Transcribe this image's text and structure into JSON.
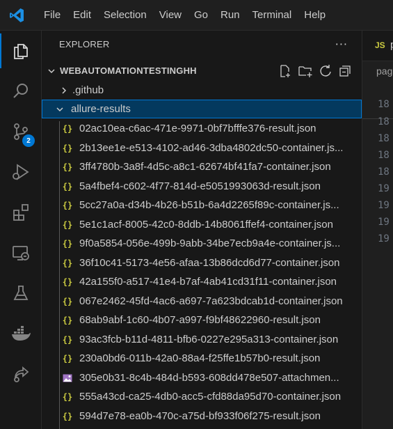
{
  "menu": [
    "File",
    "Edit",
    "Selection",
    "View",
    "Go",
    "Run",
    "Terminal",
    "Help"
  ],
  "activity_bar": {
    "items": [
      "explorer-icon",
      "search-icon",
      "source-control-icon",
      "run-debug-icon",
      "extensions-icon",
      "remote-explorer-icon",
      "testing-icon",
      "docker-icon",
      "live-share-icon"
    ],
    "source_control_badge": "2"
  },
  "explorer": {
    "header": "EXPLORER",
    "more": "···",
    "root": "WEBAUTOMATIONTESTINGHH",
    "folders": [
      ".github",
      "allure-results"
    ],
    "files": [
      {
        "name": "02ac10ea-c6ac-471e-9971-0bf7bfffe376-result.json",
        "icon": "json-icon"
      },
      {
        "name": "2b13ee1e-e513-4102-ad46-3dba4802dc50-container.js...",
        "icon": "json-icon"
      },
      {
        "name": "3ff4780b-3a8f-4d5c-a8c1-62674bf41fa7-container.json",
        "icon": "json-icon"
      },
      {
        "name": "5a4fbef4-c602-4f77-814d-e5051993063d-result.json",
        "icon": "json-icon"
      },
      {
        "name": "5cc27a0a-d34b-4b26-b51b-6a4d2265f89c-container.js...",
        "icon": "json-icon"
      },
      {
        "name": "5e1c1acf-8005-42c0-8ddb-14b8061ffef4-container.json",
        "icon": "json-icon"
      },
      {
        "name": "9f0a5854-056e-499b-9abb-34be7ecb9a4e-container.js...",
        "icon": "json-icon"
      },
      {
        "name": "36f10c41-5173-4e56-afaa-13b86dcd6d77-container.json",
        "icon": "json-icon"
      },
      {
        "name": "42a155f0-a517-41e4-b7af-4ab41cd31f11-container.json",
        "icon": "json-icon"
      },
      {
        "name": "067e2462-45fd-4ac6-a697-7a623bdcab1d-container.json",
        "icon": "json-icon"
      },
      {
        "name": "68ab9abf-1c60-4b07-a997-f9bf48622960-result.json",
        "icon": "json-icon"
      },
      {
        "name": "93ac3fcb-b11d-4811-bfb6-0227e295a313-container.json",
        "icon": "json-icon"
      },
      {
        "name": "230a0bd6-011b-42a0-88a4-f25ffe1b57b0-result.json",
        "icon": "json-icon"
      },
      {
        "name": "305e0b31-8c4b-484d-b593-608dd478e507-attachmen...",
        "icon": "image-icon"
      },
      {
        "name": "555a43cd-ca25-4db0-acc5-cfd88da95d70-container.json",
        "icon": "json-icon"
      },
      {
        "name": "594d7e78-ea0b-470c-a75d-bf933f06f275-result.json",
        "icon": "json-icon"
      }
    ]
  },
  "editor": {
    "tab_badge": "JS",
    "tab_label": "p",
    "breadcrumb": "pag",
    "line_numbers": [
      "18",
      "18",
      "18",
      "18",
      "18",
      "19",
      "19",
      "19",
      "19"
    ]
  }
}
